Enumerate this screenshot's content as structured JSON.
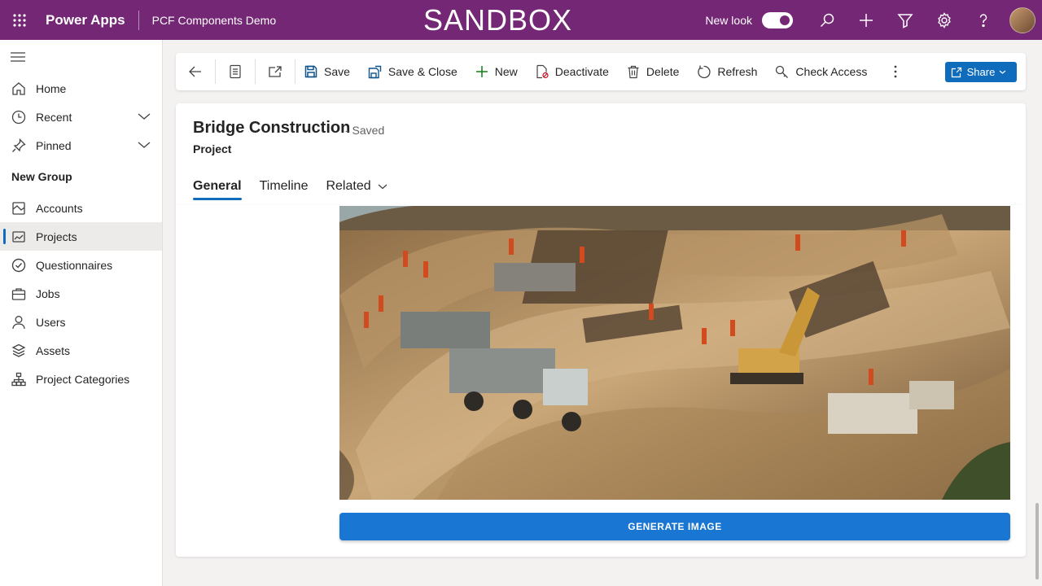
{
  "topbar": {
    "app_name": "Power Apps",
    "environment": "PCF Components Demo",
    "banner": "SANDBOX",
    "new_look_label": "New look"
  },
  "sidebar": {
    "items": [
      {
        "label": "Home",
        "icon": "home-icon"
      },
      {
        "label": "Recent",
        "icon": "clock-icon"
      },
      {
        "label": "Pinned",
        "icon": "pin-icon"
      }
    ],
    "group_title": "New Group",
    "group_items": [
      {
        "label": "Accounts",
        "icon": "accounts-icon"
      },
      {
        "label": "Projects",
        "icon": "projects-icon",
        "active": true
      },
      {
        "label": "Questionnaires",
        "icon": "questionnaire-icon"
      },
      {
        "label": "Jobs",
        "icon": "briefcase-icon"
      },
      {
        "label": "Users",
        "icon": "user-icon"
      },
      {
        "label": "Assets",
        "icon": "assets-icon"
      },
      {
        "label": "Project Categories",
        "icon": "hierarchy-icon"
      }
    ]
  },
  "commandbar": {
    "save": "Save",
    "save_close": "Save & Close",
    "new": "New",
    "deactivate": "Deactivate",
    "delete": "Delete",
    "refresh": "Refresh",
    "check_access": "Check Access",
    "share": "Share"
  },
  "record": {
    "title": "Bridge Construction",
    "status": "- Saved",
    "entity": "Project"
  },
  "tabs": [
    "General",
    "Timeline",
    "Related"
  ],
  "form": {
    "generate_button": "GENERATE IMAGE"
  },
  "colors": {
    "topbar": "#742774",
    "accent": "#0f6cbd",
    "generate_button": "#1976d2"
  }
}
